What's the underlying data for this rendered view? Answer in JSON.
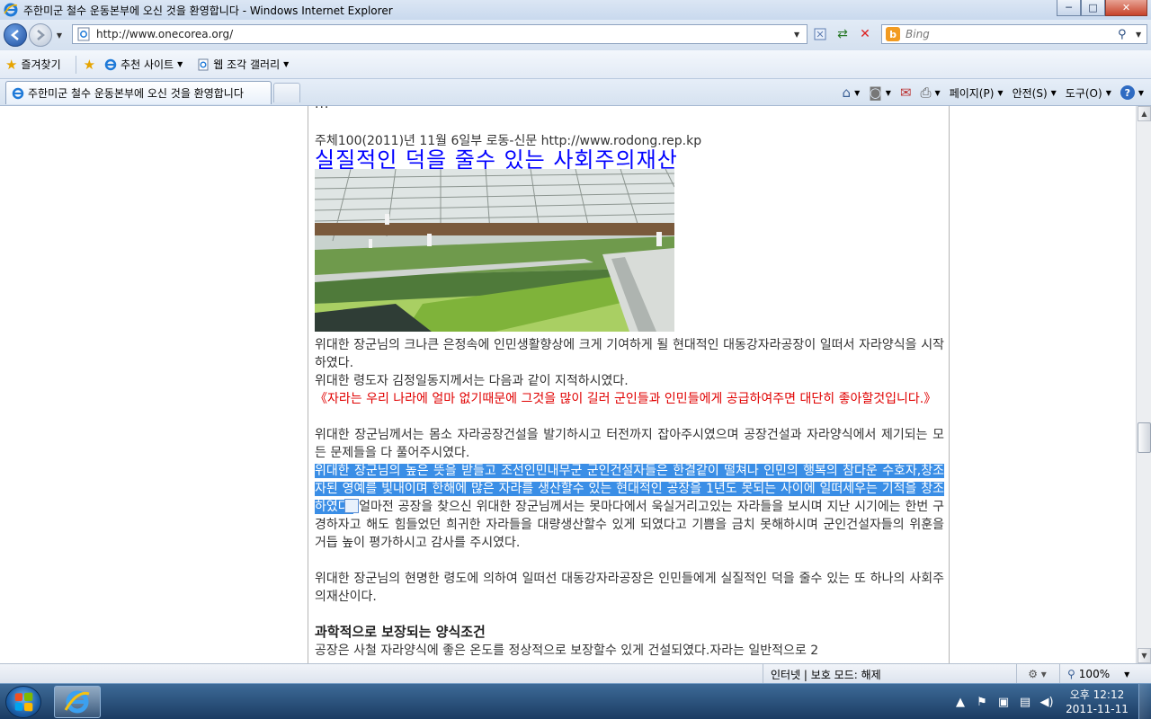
{
  "window": {
    "title": "주한미군 철수 운동본부에 오신 것을 환영합니다 - Windows Internet Explorer",
    "buttons": {
      "minimize": "─",
      "maximize": "□",
      "close": "✕"
    }
  },
  "address_bar": {
    "url": "http://www.onecorea.org/",
    "search_placeholder": "Bing",
    "search_engine_letter": "b"
  },
  "favorites_bar": {
    "favorites_label": "즐겨찾기",
    "items": [
      {
        "label": "추천 사이트"
      },
      {
        "label": "웹 조각 갤러리"
      }
    ]
  },
  "tabs": [
    {
      "label": "주한미군 철수 운동본부에 오신 것을 환영합니다",
      "active": true
    }
  ],
  "command_bar": {
    "page_label": "페이지(P)",
    "safety_label": "안전(S)",
    "tools_label": "도구(O)"
  },
  "article": {
    "cut_top_text": "...",
    "dateline": "주체100(2011)년 11월 6일부 로동-신문 http://www.rodong.rep.kp",
    "headline": "실질적인 덕을 줄수 있는 사회주의재산",
    "paragraphs": [
      "위대한 장군님의 크나큰 은정속에 인민생활향상에 크게 기여하게 될 현대적인 대동강자라공장이 일떠서 자라양식을 시작하였다.",
      "위대한 령도자 김정일동지께서는 다음과 같이 지적하시였다.",
      "위대한 장군님께서는 몸소 자라공장건설을 발기하시고 터전까지 잡아주시였으며 공장건설과 자라양식에서 제기되는 모든 문제들을 다 풀어주시였다."
    ],
    "quote": "《자라는 우리 나라에 얼마 없기때문에 그것을 많이 길러 군인들과 인민들에게 공급하여주면 대단히 좋아할것입니다.》",
    "highlighted_text": "위대한 장군님의 높은 뜻을 받들고 조선인민내무군 군인건설자들은 한결같이 떨쳐나 인민의 행복의 참다운 수호자,창조자된 영예를 빛내이며 한해에 많은 자라를 생산할수 있는 현대적인 공장을 1년도 못되는 사이에 일떠세우는 기적을 창조하였다.",
    "after_highlight": "얼마전 공장을 찾으신 위대한 장군님께서는 못마다에서 욱실거리고있는 자라들을 보시며 지난 시기에는 한번 구경하자고 해도 힘들었던 희귀한 자라들을 대량생산할수 있게 되였다고 기쁨을 금치 못해하시며 군인건설자들의 위훈을 거듭 높이 평가하시고 감사를 주시였다.",
    "closing": "위대한 장군님의 현명한 령도에 의하여 일떠선 대동강자라공장은 인민들에게 실질적인 덕을 줄수 있는 또 하나의 사회주의재산이다.",
    "subhead": "과학적으로 보장되는 양식조건",
    "last_line": "공장은 사철 자라양식에 좋은 온도를 정상적으로 보장할수 있게 건설되였다.자라는 일반적으로 2"
  },
  "status_bar": {
    "zone": "인터넷 | 보호 모드: 해제",
    "zoom": "100%"
  },
  "taskbar": {
    "time": "오후 12:12",
    "date": "2011-11-11"
  },
  "colors": {
    "headline": "#0000ff",
    "quote": "#e00000",
    "selection": "#3a8ee6"
  }
}
